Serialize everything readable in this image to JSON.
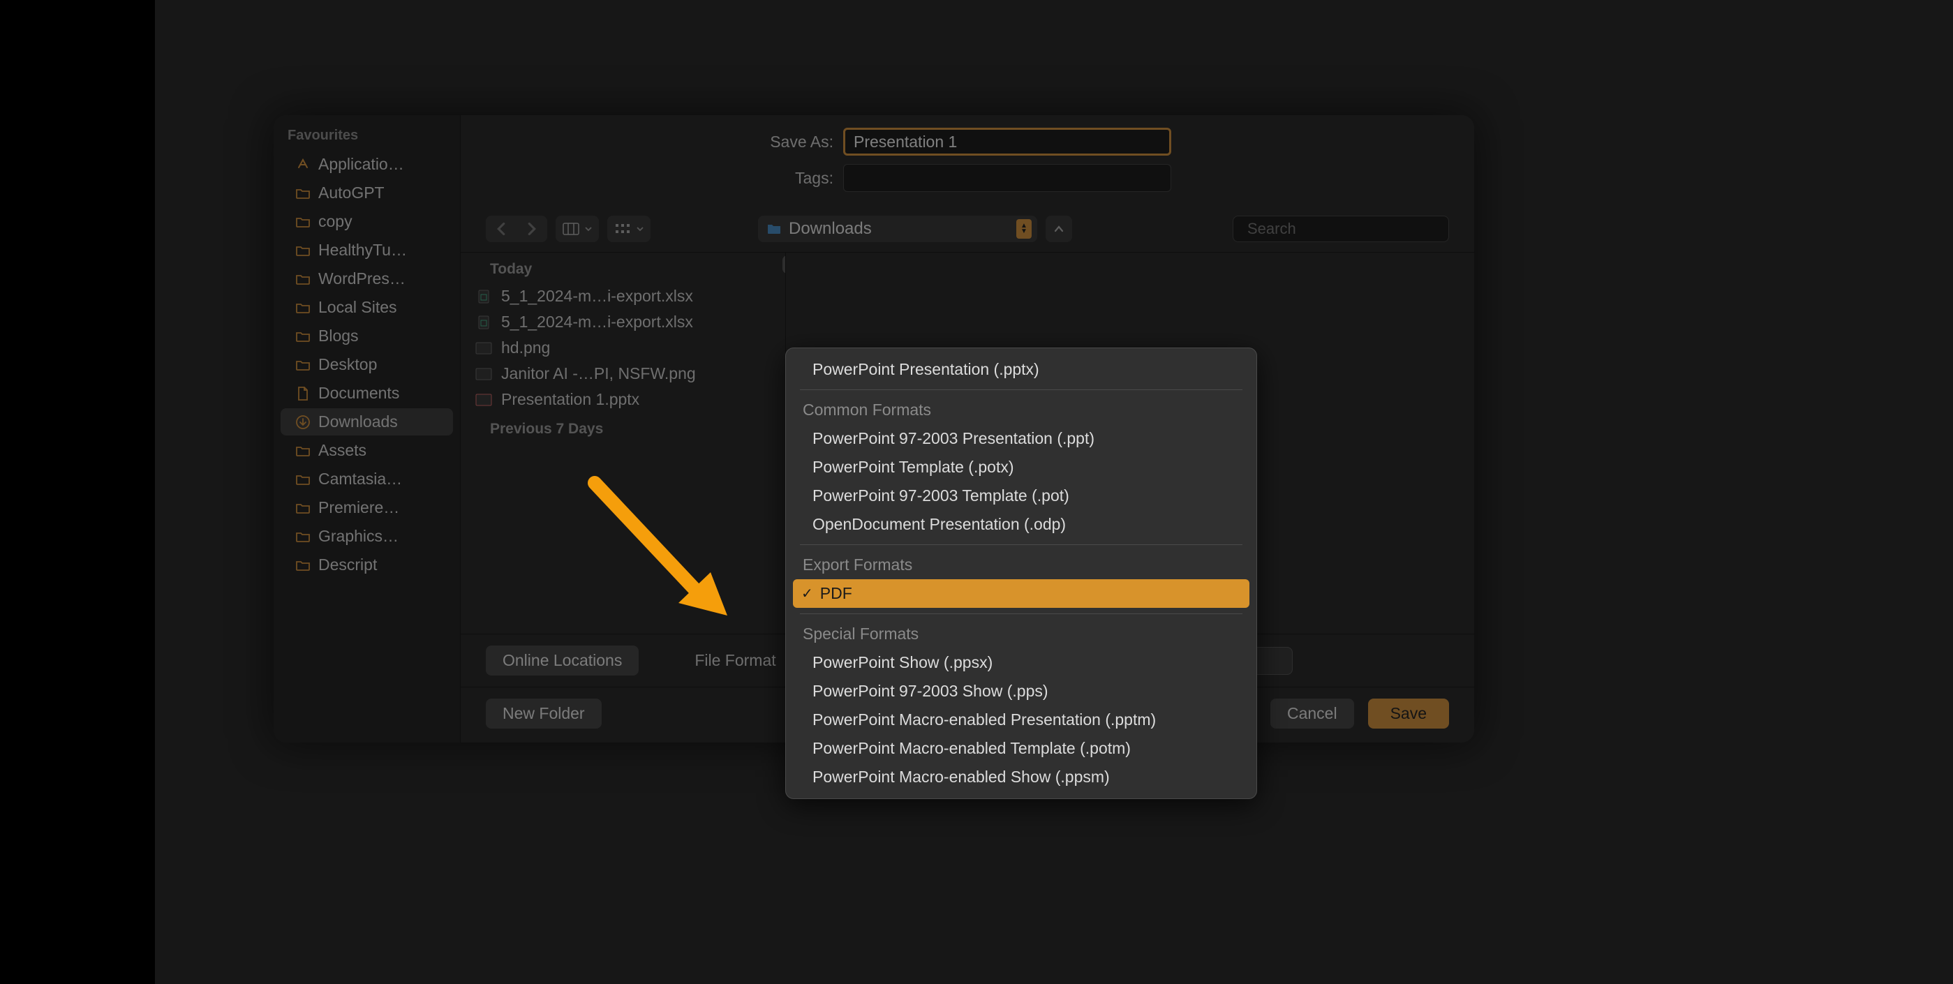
{
  "sidebar": {
    "header": "Favourites",
    "items": [
      {
        "label": "Applicatio…",
        "icon": "apps"
      },
      {
        "label": "AutoGPT",
        "icon": "folder"
      },
      {
        "label": "copy",
        "icon": "folder"
      },
      {
        "label": "HealthyTu…",
        "icon": "folder"
      },
      {
        "label": "WordPres…",
        "icon": "folder"
      },
      {
        "label": "Local Sites",
        "icon": "folder"
      },
      {
        "label": "Blogs",
        "icon": "folder"
      },
      {
        "label": "Desktop",
        "icon": "folder"
      },
      {
        "label": "Documents",
        "icon": "document"
      },
      {
        "label": "Downloads",
        "icon": "download",
        "selected": true
      },
      {
        "label": "Assets",
        "icon": "folder"
      },
      {
        "label": "Camtasia…",
        "icon": "folder"
      },
      {
        "label": "Premiere…",
        "icon": "folder"
      },
      {
        "label": "Graphics…",
        "icon": "folder"
      },
      {
        "label": "Descript",
        "icon": "folder"
      }
    ]
  },
  "fields": {
    "save_as_label": "Save As:",
    "save_as_value": "Presentation 1",
    "tags_label": "Tags:",
    "tags_value": ""
  },
  "toolbar": {
    "location": "Downloads",
    "search_placeholder": "Search"
  },
  "files": {
    "sections": [
      {
        "header": "Today",
        "items": [
          {
            "name": "5_1_2024-m…i-export.xlsx",
            "icon": "sheet"
          },
          {
            "name": "5_1_2024-m…i-export.xlsx",
            "icon": "sheet"
          },
          {
            "name": "hd.png",
            "icon": "image"
          },
          {
            "name": "Janitor AI -…PI, NSFW.png",
            "icon": "image"
          },
          {
            "name": "Presentation 1.pptx",
            "icon": "presentation"
          }
        ]
      },
      {
        "header": "Previous 7 Days",
        "items": []
      }
    ]
  },
  "buttons": {
    "online_locations": "Online Locations",
    "file_format": "File Format",
    "new_folder": "New Folder",
    "cancel": "Cancel",
    "save": "Save"
  },
  "dropdown": {
    "top_item": "PowerPoint Presentation (.pptx)",
    "groups": [
      {
        "header": "Common Formats",
        "items": [
          "PowerPoint 97-2003 Presentation (.ppt)",
          "PowerPoint Template (.potx)",
          "PowerPoint 97-2003 Template (.pot)",
          "OpenDocument Presentation (.odp)"
        ]
      },
      {
        "header": "Export Formats",
        "items": [
          "PDF"
        ],
        "selected_index": 0
      },
      {
        "header": "Special Formats",
        "items": [
          "PowerPoint Show (.ppsx)",
          "PowerPoint 97-2003 Show (.pps)",
          "PowerPoint Macro-enabled Presentation (.pptm)",
          "PowerPoint Macro-enabled Template (.potm)",
          "PowerPoint Macro-enabled Show (.ppsm)"
        ]
      }
    ]
  },
  "colors": {
    "accent": "#cc8e3f"
  }
}
